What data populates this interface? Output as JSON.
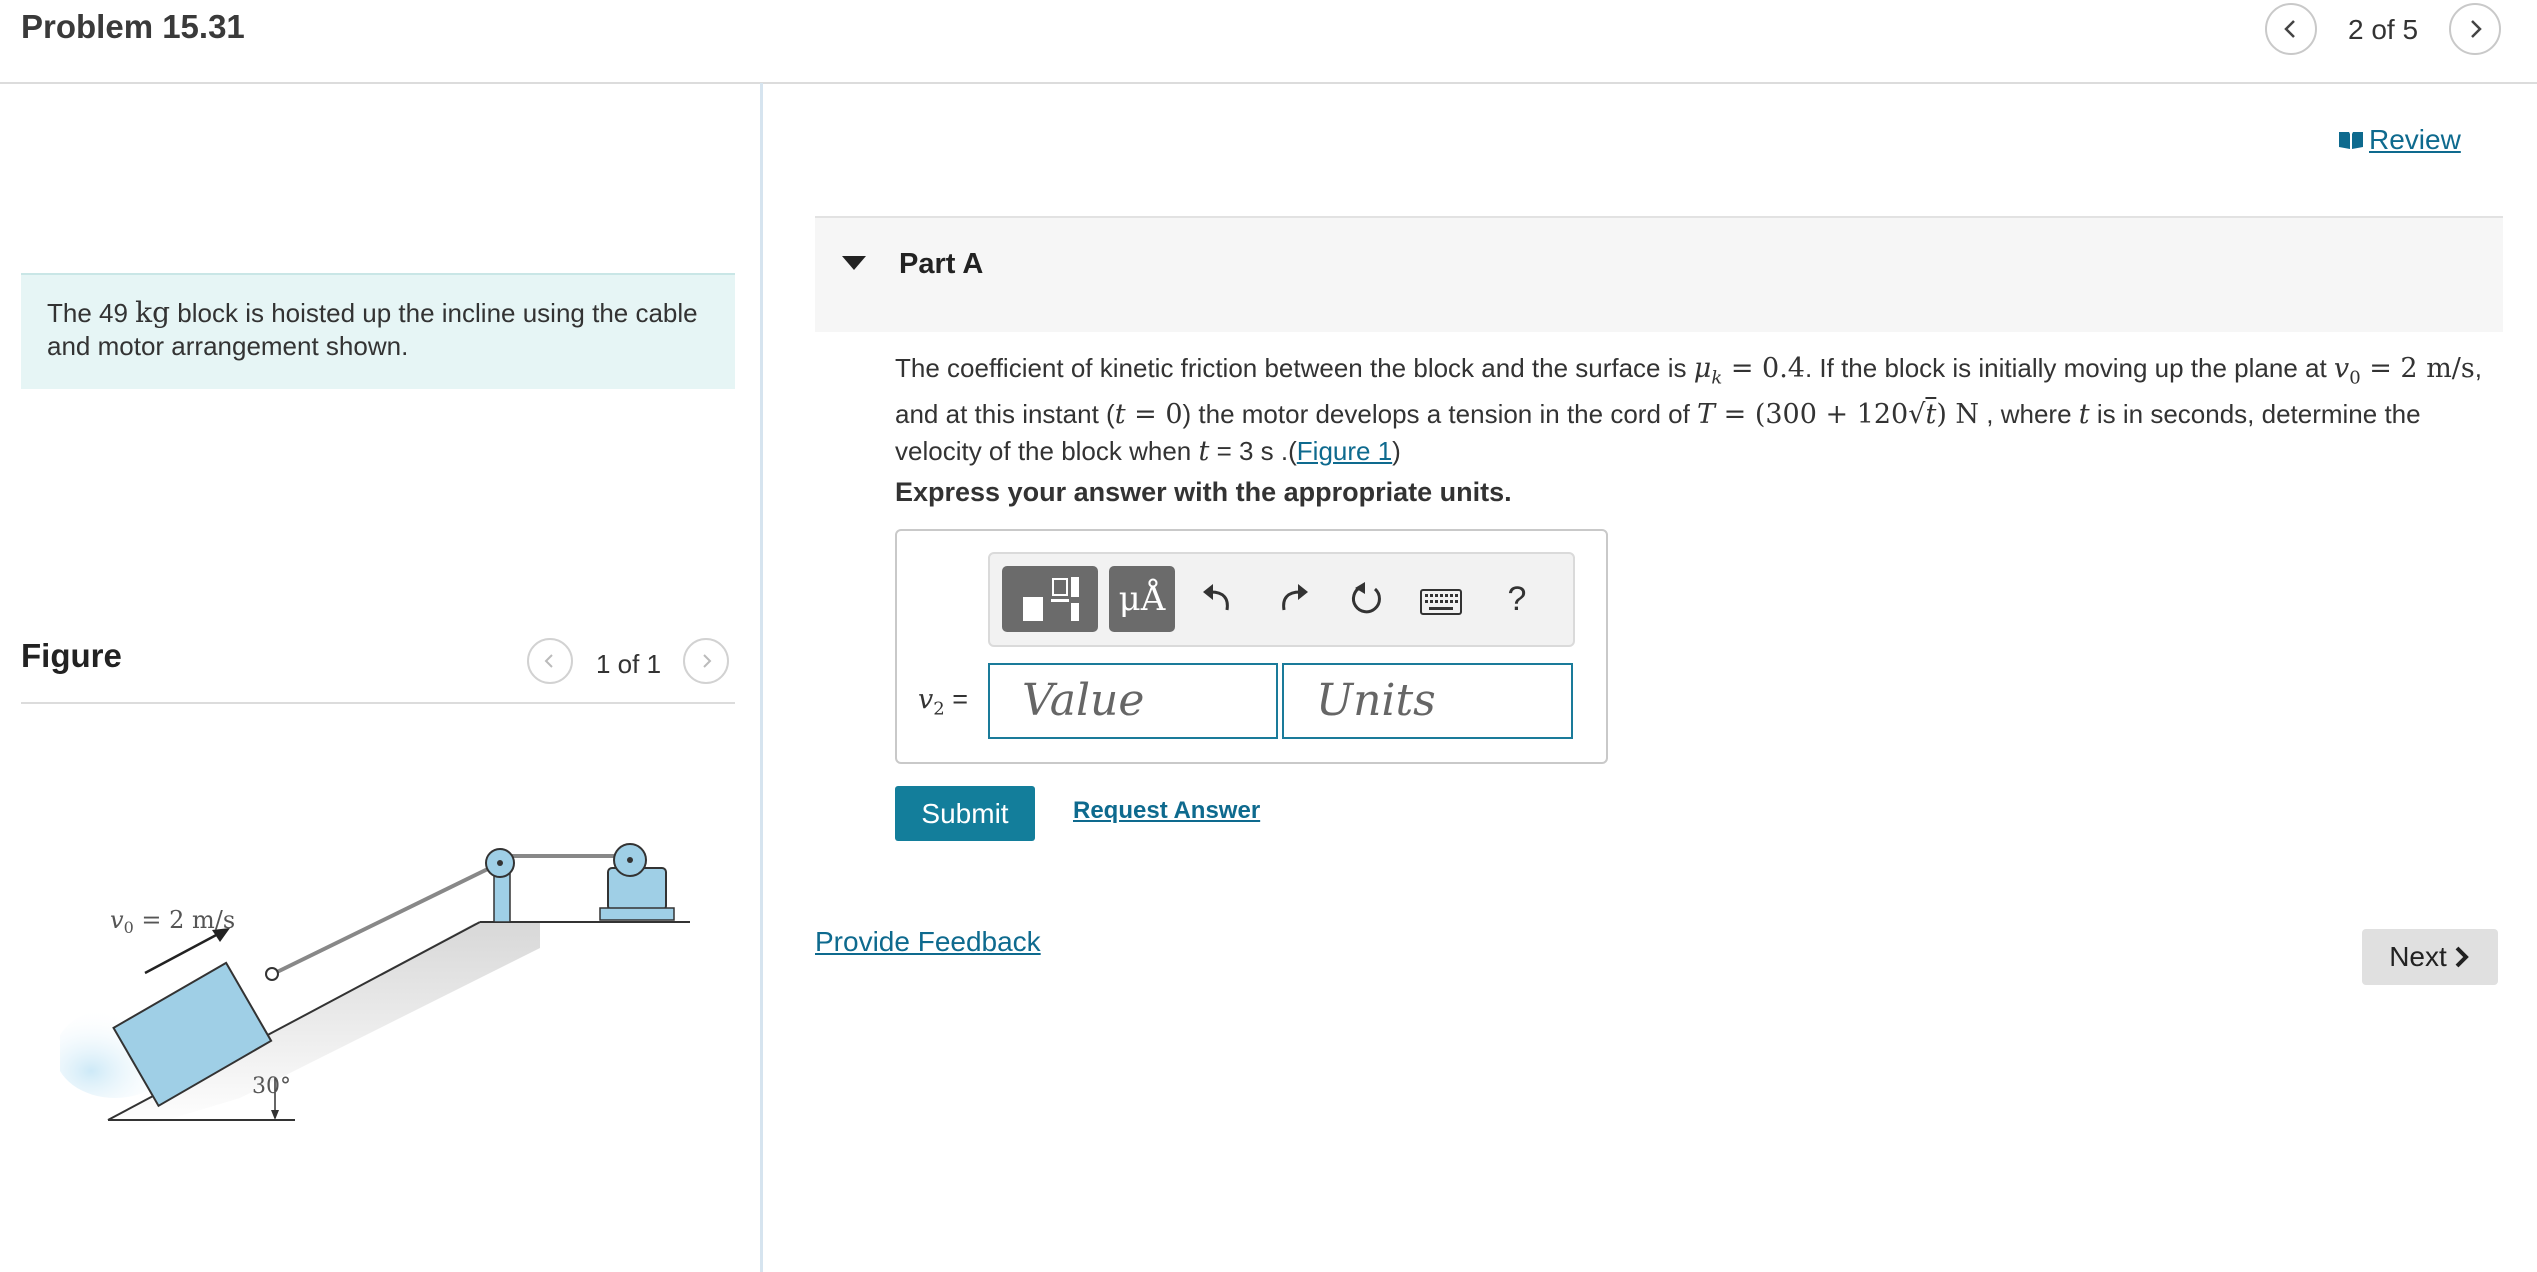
{
  "header": {
    "title": "Problem 15.31",
    "counter": "2 of 5"
  },
  "intro": {
    "before": "The 49 ",
    "unit": "kg",
    "after": " block is hoisted up the incline using the cable and motor arrangement shown."
  },
  "figure": {
    "heading": "Figure",
    "counter": "1 of 1",
    "v0_label": "v",
    "v0_sub": "0",
    "v0_value": " = 2 m/s",
    "angle_label": "30°"
  },
  "review": {
    "label": "Review"
  },
  "part": {
    "title": "Part A"
  },
  "question": {
    "t1": "The coefficient of kinetic friction between the block and the surface is ",
    "mu": "μ",
    "mu_sub": "k",
    "mu_val": " = 0.4",
    "t2": ". If the block is initially moving up the plane at ",
    "v": "v",
    "v_sub": "0",
    "v_val": " = 2 m/s",
    "t3": ", and at this instant (",
    "t_var": "t",
    "t_eq": " = 0",
    "t4": ") the motor develops a tension in the cord of ",
    "T": "T",
    "T_eq1": " = (300 + 120",
    "sqrt_arg": "t",
    "T_eq2": ") N",
    "t5": " , where ",
    "t_var2": "t",
    "t6": " is in seconds, determine the velocity of the block when ",
    "t_var3": "t",
    "t7": " = 3 s .(",
    "figure_link": "Figure 1",
    "t8": ")"
  },
  "instruction": "Express your answer with the appropriate units.",
  "answer": {
    "label_v": "v",
    "label_sub": "2",
    "label_eq": " =",
    "value_placeholder": "Value",
    "units_placeholder": "Units",
    "symbols_label": "μÅ",
    "help_label": "?"
  },
  "actions": {
    "submit": "Submit",
    "request_answer": "Request Answer",
    "feedback": "Provide Feedback",
    "next": "Next"
  },
  "colors": {
    "accent": "#137e9b",
    "link": "#0e6a8e",
    "intro_bg": "#e6f5f5",
    "block": "#9fcfe6"
  },
  "icons": [
    "chevron-left-icon",
    "chevron-right-icon",
    "book-icon",
    "templates-icon",
    "undo-icon",
    "redo-icon",
    "reset-icon",
    "keyboard-icon"
  ]
}
